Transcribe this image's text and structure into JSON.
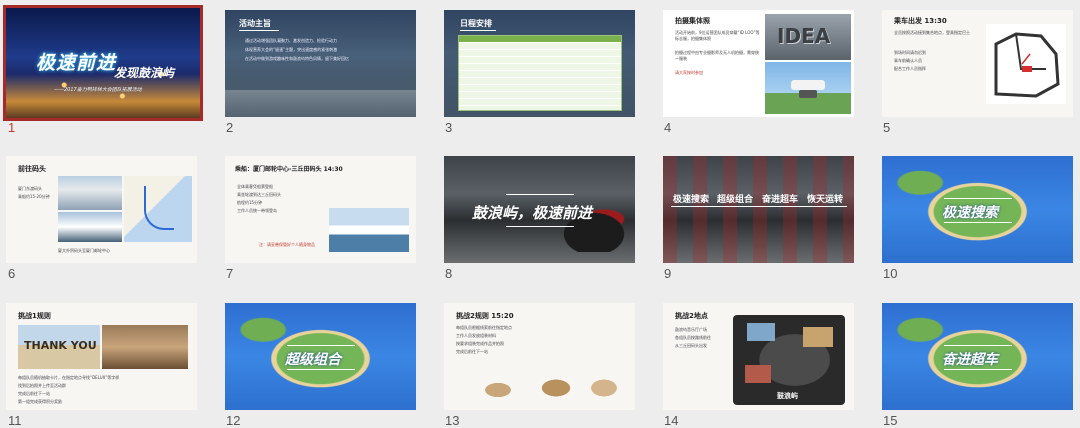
{
  "slides": [
    {
      "num": "1",
      "title": "极速前进",
      "subtitle": "发现鼓浪屿",
      "caption": "——2017奋力鸭祥林大会团队拓展活动"
    },
    {
      "num": "2",
      "title": "活动主旨",
      "bullets": [
        "通过活动增强团队凝聚力、激发创造力、检验行动力",
        "体现营养大会的“极速”主题，突出速度感的紧张刺激",
        "在活动中做到游戏趣味性和鼓浪屿特色风情，留下美好回忆"
      ]
    },
    {
      "num": "3",
      "title": "日程安排"
    },
    {
      "num": "4",
      "title": "拍摄集体照",
      "bullets": [
        "活动开始前，9位运营团队成员穿戴“ID LOO”等标志服，拍摄集体照",
        "拍摄过程中由专业摄影师及无人机拍摄，需穿统一服装",
        "请大家按时参加"
      ],
      "img_text": "IDEA"
    },
    {
      "num": "5",
      "title": "乘车出发 13:30",
      "bullets": [
        "全员按照活动接到集合地点，登乘指定巴士",
        "到场时间请勿迟到",
        "乘车前确认人员",
        "配合工作人员指挥"
      ]
    },
    {
      "num": "6",
      "title": "前往码头",
      "bullets": [
        "厦门东渡码头",
        "乘船约15-20分钟"
      ],
      "caption": "厦大外贸码头至厦门邮轮中心"
    },
    {
      "num": "7",
      "title": "乘船：厦门邮轮中心-三丘田码头 14:30",
      "bullets": [
        "全体乘客凭船票登船",
        "乘坐轮渡到达三丘田码头",
        "航程约15分钟",
        "工作人员统一带领登岛"
      ],
      "note": "注：请妥善保管好个人随身物品"
    },
    {
      "num": "8",
      "title": "鼓浪屿，极速前进"
    },
    {
      "num": "9",
      "labels": [
        "极速搜索",
        "超级组合",
        "奋进超车",
        "恢天运转"
      ]
    },
    {
      "num": "10",
      "title": "极速搜索"
    },
    {
      "num": "11",
      "title": "挑战1规则",
      "img_text": "THANK YOU",
      "bullets": [
        "每组队员随机抽取卡片，在指定地点寻找“DELUX”等字样",
        "找到后拍照并上传至活动群",
        "完成后前往下一站",
        "第一组完成获得积分奖励"
      ]
    },
    {
      "num": "12",
      "title": "超级组合"
    },
    {
      "num": "13",
      "title": "挑战2规则 15:20",
      "bullets": [
        "每组队员根据线索前往指定地点",
        "工作人员发放组装材料",
        "按要求组装完成作品并拍照",
        "完成后前往下一站"
      ]
    },
    {
      "num": "14",
      "title": "挑战2地点",
      "bullets": [
        "鼓浪屿音乐厅广场",
        "各组队员按路线前往",
        "从三丘田码头出发"
      ],
      "logo": "鼓浪屿"
    },
    {
      "num": "15",
      "title": "奋进超车"
    }
  ]
}
